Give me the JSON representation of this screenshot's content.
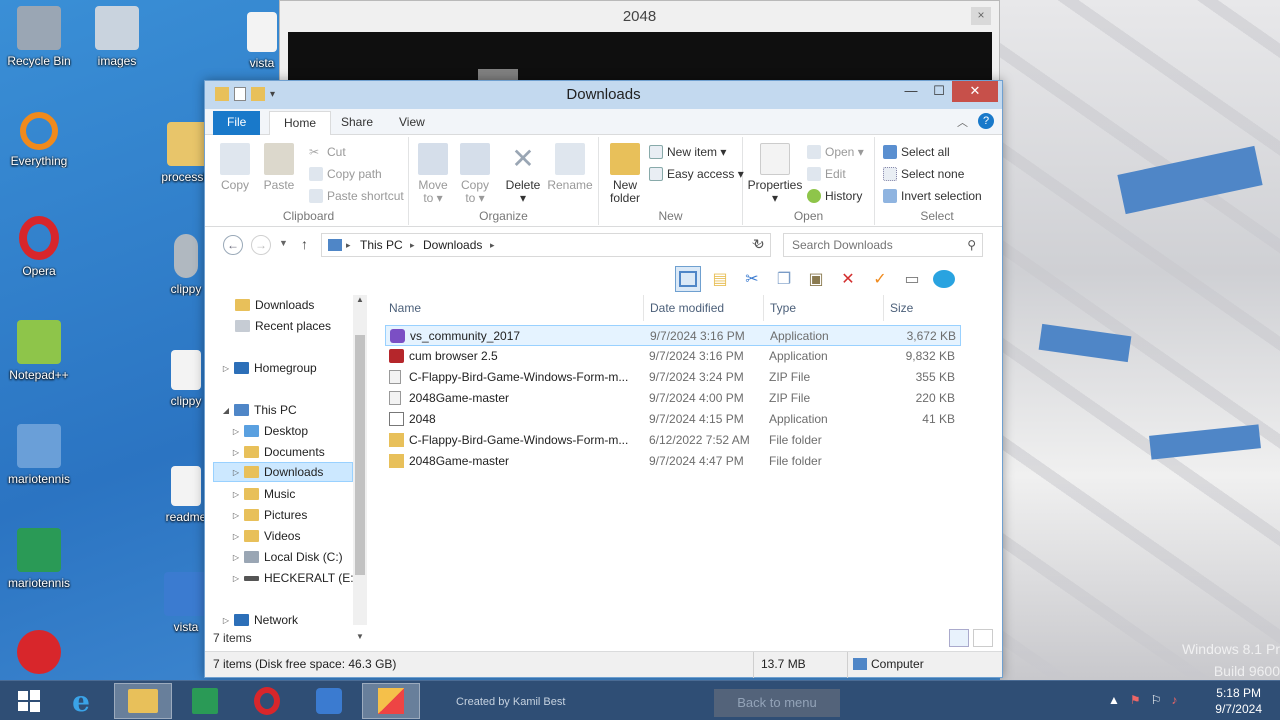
{
  "window_2048": {
    "title": "2048",
    "close": "×"
  },
  "desktop_icons": [
    {
      "label": "Recycle Bin",
      "color": "#9aa6b4"
    },
    {
      "label": "images",
      "color": "#c9d3de"
    },
    {
      "label": "vista",
      "color": "#f3f3f3"
    },
    {
      "label": "Everything",
      "color": "#f08a1c"
    },
    {
      "label": "processha",
      "color": "#e8c56a"
    },
    {
      "label": "Opera",
      "color": "#d8262b"
    },
    {
      "label": "clippy",
      "color": "#b0b8c0"
    },
    {
      "label": "Notepad++",
      "color": "#8ec54a"
    },
    {
      "label": "clippy",
      "color": "#f3f3f3"
    },
    {
      "label": "mariotennis",
      "color": "#6a9fd8"
    },
    {
      "label": "readme",
      "color": "#f3f3f3"
    },
    {
      "label": "mariotennis",
      "color": "#2a9a56"
    },
    {
      "label": "vista",
      "color": "#3b7bd0"
    }
  ],
  "explorer": {
    "title": "Downloads",
    "controls": {
      "minimize": "—",
      "maximize": "☐",
      "close": "✕"
    },
    "tabs": {
      "file": "File",
      "home": "Home",
      "share": "Share",
      "view": "View"
    },
    "ribbon": {
      "clipboard": {
        "copy": "Copy",
        "paste": "Paste",
        "cut": "Cut",
        "copy_path": "Copy path",
        "paste_shortcut": "Paste shortcut",
        "label": "Clipboard"
      },
      "organize": {
        "move_to": "Move",
        "move_to2": "to ▾",
        "copy_to": "Copy",
        "copy_to2": "to ▾",
        "delete": "Delete",
        "delete2": "▾",
        "rename": "Rename",
        "label": "Organize"
      },
      "new": {
        "new_folder": "New",
        "new_folder2": "folder",
        "new_item": "New item ▾",
        "easy_access": "Easy access ▾",
        "label": "New"
      },
      "open": {
        "properties": "Properties",
        "properties2": "▾",
        "open": "Open ▾",
        "edit": "Edit",
        "history": "History",
        "label": "Open"
      },
      "select": {
        "select_all": "Select all",
        "select_none": "Select none",
        "invert": "Invert selection",
        "label": "Select"
      }
    },
    "address": {
      "crumb1": "This PC",
      "crumb2": "Downloads",
      "sep": "▸",
      "search_placeholder": "Search Downloads"
    },
    "nav": [
      {
        "label": "Downloads",
        "color": "#e8c05a"
      },
      {
        "label": "Recent places",
        "color": "#c6ccd4"
      },
      {
        "label": "Homegroup",
        "color": "#2c6fb8"
      },
      {
        "label": "This PC",
        "color": "#4f86c7"
      },
      {
        "label": "Desktop",
        "color": "#5aa0e0"
      },
      {
        "label": "Documents",
        "color": "#e8c05a"
      },
      {
        "label": "Downloads",
        "color": "#e8c05a"
      },
      {
        "label": "Music",
        "color": "#e8c05a"
      },
      {
        "label": "Pictures",
        "color": "#e8c05a"
      },
      {
        "label": "Videos",
        "color": "#e8c05a"
      },
      {
        "label": "Local Disk (C:)",
        "color": "#9aa6b4"
      },
      {
        "label": "HECKERALT (E:)",
        "color": "#555555"
      },
      {
        "label": "Network",
        "color": "#2c6fb8"
      }
    ],
    "columns": {
      "name": "Name",
      "date": "Date modified",
      "type": "Type",
      "size": "Size"
    },
    "files": [
      {
        "name": "vs_community_2017",
        "date": "9/7/2024 3:16 PM",
        "type": "Application",
        "size": "3,672 KB",
        "color": "#7b4fc4"
      },
      {
        "name": "cum browser 2.5",
        "date": "9/7/2024 3:16 PM",
        "type": "Application",
        "size": "9,832 KB",
        "color": "#b5262b"
      },
      {
        "name": "C-Flappy-Bird-Game-Windows-Form-m...",
        "date": "9/7/2024 3:24 PM",
        "type": "ZIP File",
        "size": "355 KB",
        "color": "#d8d8d8"
      },
      {
        "name": "2048Game-master",
        "date": "9/7/2024 4:00 PM",
        "type": "ZIP File",
        "size": "220 KB",
        "color": "#d8d8d8"
      },
      {
        "name": "2048",
        "date": "9/7/2024 4:15 PM",
        "type": "Application",
        "size": "41 KB",
        "color": "#9aa6b4"
      },
      {
        "name": "C-Flappy-Bird-Game-Windows-Form-m...",
        "date": "6/12/2022 7:52 AM",
        "type": "File folder",
        "size": "",
        "color": "#e8c05a"
      },
      {
        "name": "2048Game-master",
        "date": "9/7/2024 4:47 PM",
        "type": "File folder",
        "size": "",
        "color": "#e8c05a"
      }
    ],
    "item_count": "7 items",
    "status": {
      "left": "7 items (Disk free space: 46.3 GB)",
      "size": "13.7 MB",
      "location": "Computer"
    }
  },
  "taskbar": {
    "credit": "Created by Kamil Best",
    "back_button": "Back to menu",
    "time": "5:18 PM",
    "date": "9/7/2024",
    "watermark1": "Windows 8.1 Pr",
    "watermark2": "Build 9600"
  }
}
